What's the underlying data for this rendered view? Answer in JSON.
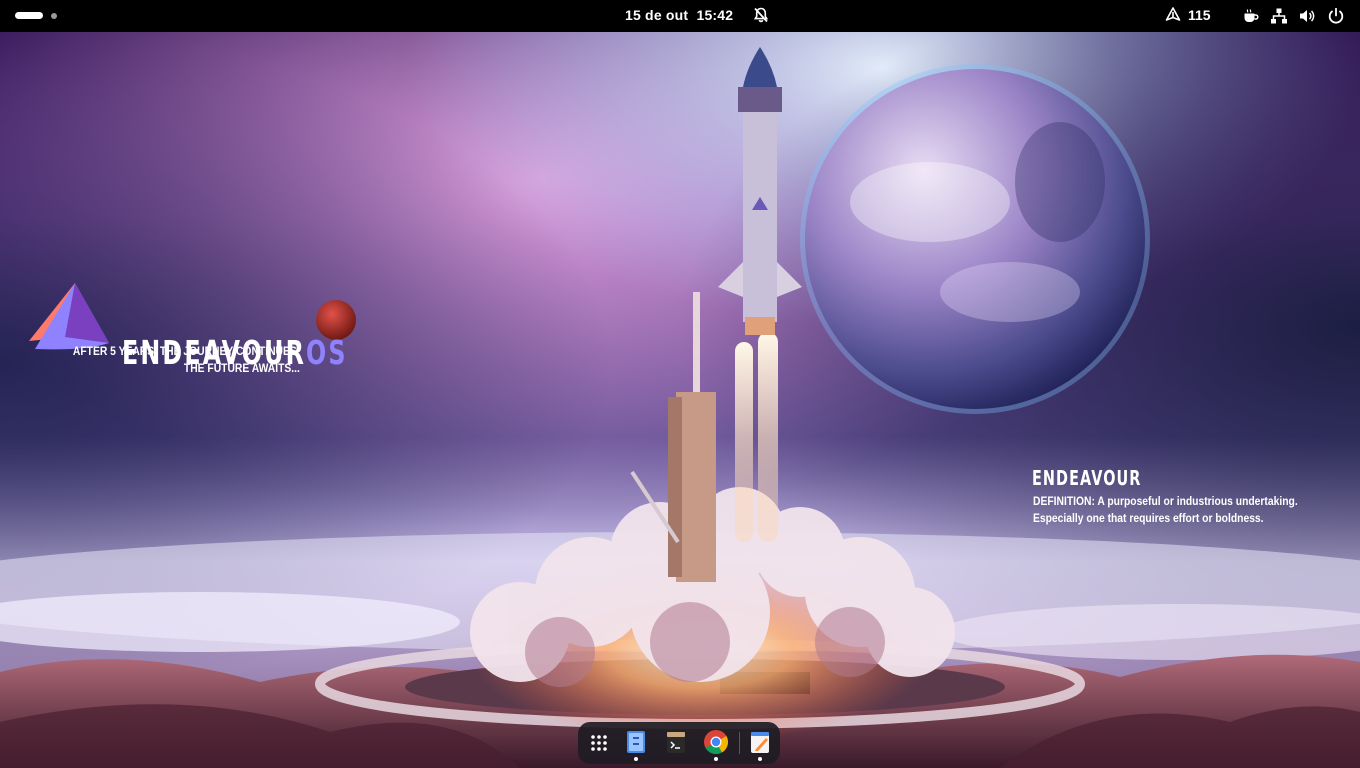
{
  "topbar": {
    "date": "15 de out",
    "time": "15:42",
    "updates_count": "115",
    "icons": [
      "dnd-bell-off-icon",
      "update-arrow-icon",
      "caffeine-cup-icon",
      "network-wired-icon",
      "volume-icon",
      "power-icon"
    ]
  },
  "wallpaper": {
    "brand_name_main": "ENDEAVOUR",
    "brand_name_os": "OS",
    "tagline_1": "AFTER 5 YEARS, THE JOURNEY CONTINUES.",
    "tagline_2": "THE FUTURE AWAITS...",
    "definition_title": "ENDEAVOUR",
    "definition_line_1": "DEFINITION: A purposeful or industrious undertaking.",
    "definition_line_2": "Especially one that requires effort or boldness."
  },
  "dock": {
    "apps": [
      {
        "name": "app-grid-icon",
        "running": false
      },
      {
        "name": "files-icon",
        "running": true
      },
      {
        "name": "terminal-icon",
        "running": false
      },
      {
        "name": "chrome-icon",
        "running": true
      },
      {
        "name": "text-editor-icon",
        "running": true
      }
    ]
  },
  "colors": {
    "accent": "#8f82ff",
    "topbar": "#000000"
  }
}
